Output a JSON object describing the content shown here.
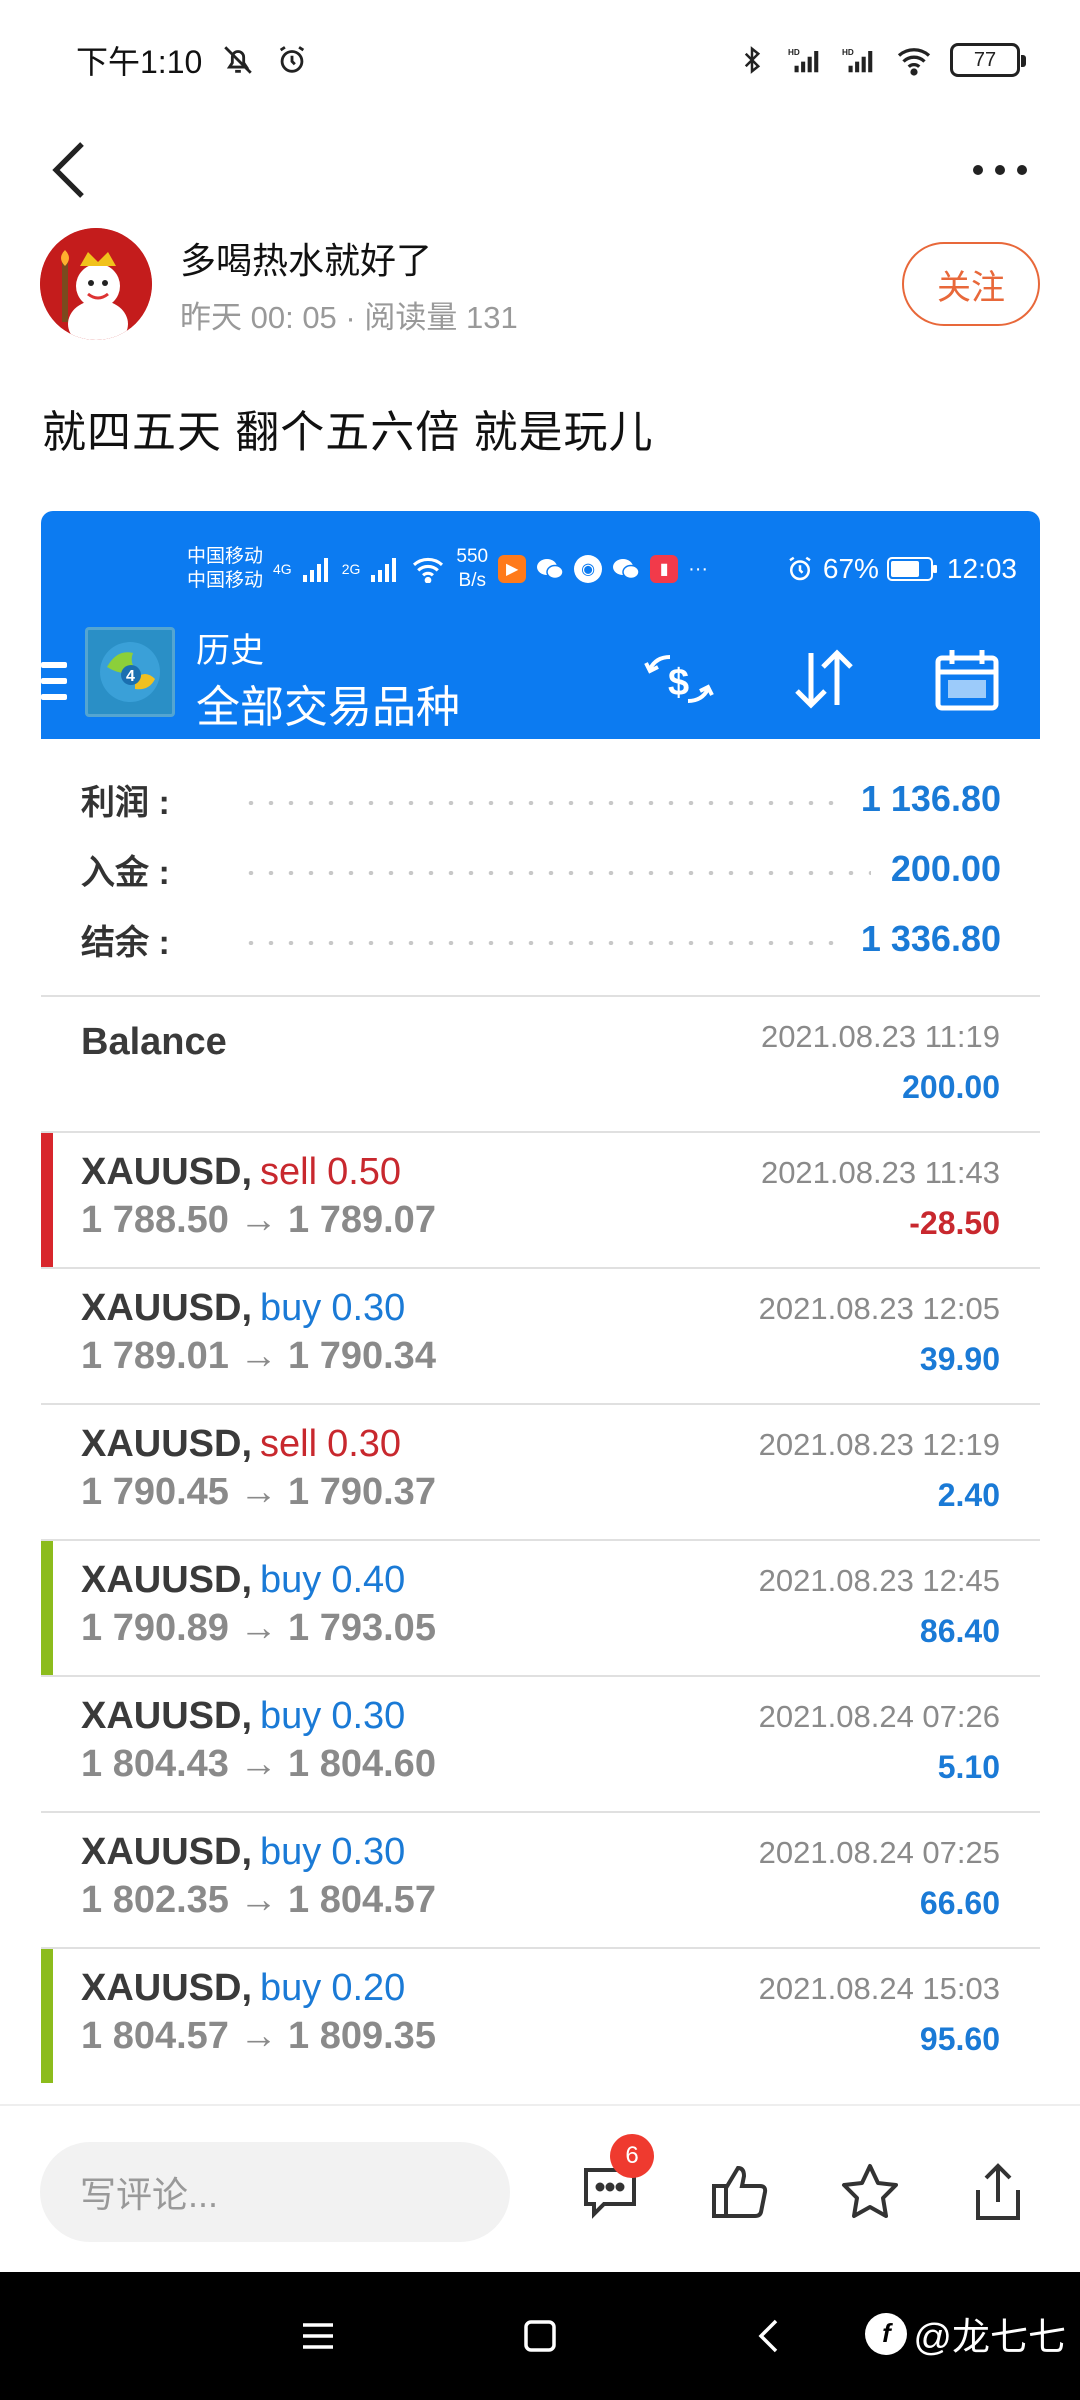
{
  "status_bar": {
    "time": "下午1:10",
    "battery": "77"
  },
  "author": {
    "name": "多喝热水就好了",
    "meta": "昨天 00: 05 · 阅读量 131",
    "follow_label": "关注"
  },
  "post": {
    "text": "就四五天 翻个五六倍 就是玩儿"
  },
  "embedded_status": {
    "carrier1": "中国移动",
    "carrier2": "中国移动",
    "net1": "4G",
    "net2": "2G",
    "speed_value": "550",
    "speed_unit": "B/s",
    "battery": "67%",
    "time": "12:03"
  },
  "mt_app": {
    "subtitle": "历史",
    "title": "全部交易品种"
  },
  "summary": [
    {
      "label": "利润 :",
      "value": "1 136.80"
    },
    {
      "label": "入金 :",
      "value": "200.00"
    },
    {
      "label": "结余 :",
      "value": "1 336.80"
    }
  ],
  "balance_entry": {
    "title": "Balance",
    "time": "2021.08.23 11:19",
    "amount": "200.00"
  },
  "deals": [
    {
      "symbol": "XAUUSD,",
      "side": "sell",
      "volume": "0.50",
      "prices": "1 788.50 → 1 789.07",
      "time": "2021.08.23 11:43",
      "profit": "-28.50",
      "bar_color": "#d8262c"
    },
    {
      "symbol": "XAUUSD,",
      "side": "buy",
      "volume": "0.30",
      "prices": "1 789.01 → 1 790.34",
      "time": "2021.08.23 12:05",
      "profit": "39.90",
      "bar_color": ""
    },
    {
      "symbol": "XAUUSD,",
      "side": "sell",
      "volume": "0.30",
      "prices": "1 790.45 → 1 790.37",
      "time": "2021.08.23 12:19",
      "profit": "2.40",
      "bar_color": ""
    },
    {
      "symbol": "XAUUSD,",
      "side": "buy",
      "volume": "0.40",
      "prices": "1 790.89 → 1 793.05",
      "time": "2021.08.23 12:45",
      "profit": "86.40",
      "bar_color": "#8cbc1c"
    },
    {
      "symbol": "XAUUSD,",
      "side": "buy",
      "volume": "0.30",
      "prices": "1 804.43 → 1 804.60",
      "time": "2021.08.24 07:26",
      "profit": "5.10",
      "bar_color": ""
    },
    {
      "symbol": "XAUUSD,",
      "side": "buy",
      "volume": "0.30",
      "prices": "1 802.35 → 1 804.57",
      "time": "2021.08.24 07:25",
      "profit": "66.60",
      "bar_color": ""
    },
    {
      "symbol": "XAUUSD,",
      "side": "buy",
      "volume": "0.20",
      "prices": "1 804.57 → 1 809.35",
      "time": "2021.08.24 15:03",
      "profit": "95.60",
      "bar_color": "#8cbc1c"
    }
  ],
  "action_bar": {
    "comment_placeholder": "写评论...",
    "comment_count": "6"
  },
  "watermark": {
    "text": "@龙七七"
  },
  "colors": {
    "accent": "#e8683a",
    "mt_blue": "#0c7bf1",
    "positive": "#1a7ad6",
    "negative": "#c8282e"
  }
}
